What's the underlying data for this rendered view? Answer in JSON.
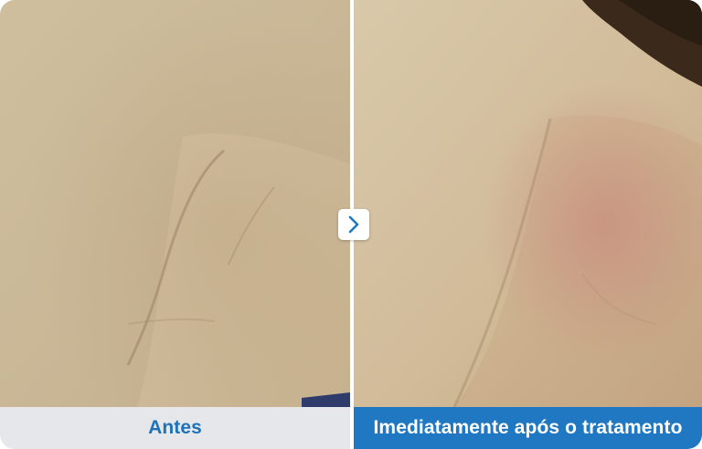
{
  "comparison": {
    "before_label": "Antes",
    "after_label": "Imediatamente após o tratamento"
  },
  "icons": {
    "next": "chevron-right-icon"
  },
  "colors": {
    "accent": "#1f78c1",
    "before_caption_bg": "#e5e7ea",
    "before_caption_text": "#1d72b8",
    "after_caption_text": "#ffffff",
    "skin_tone": "#cdb797"
  }
}
